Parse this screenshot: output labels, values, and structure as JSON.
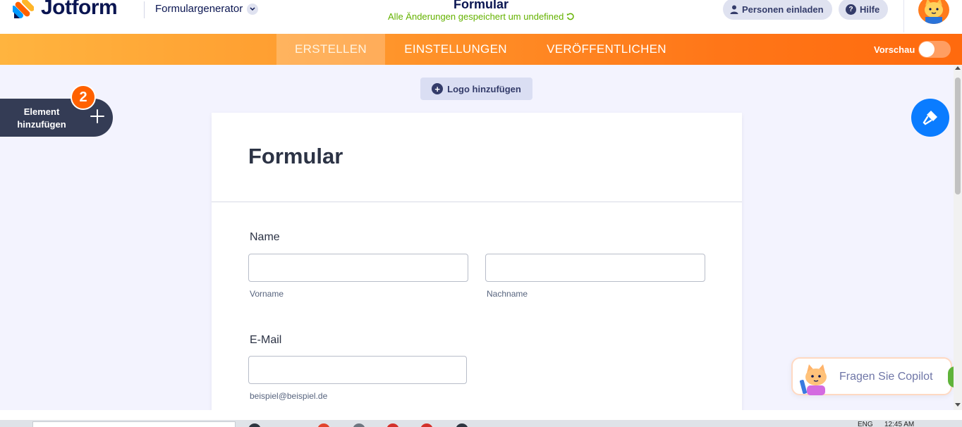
{
  "header": {
    "brand": "Jotform",
    "builder_label": "Formulargenerator",
    "form_title": "Formular",
    "save_status": "Alle Änderungen gespeichert um undefined",
    "invite_label": "Personen einladen",
    "help_label": "Hilfe"
  },
  "nav": {
    "tabs": [
      {
        "label": "ERSTELLEN",
        "active": true
      },
      {
        "label": "EINSTELLUNGEN",
        "active": false
      },
      {
        "label": "VERÖFFENTLICHEN",
        "active": false
      }
    ],
    "preview_label": "Vorschau",
    "preview_on": false
  },
  "sidebar": {
    "add_element_label": "Element hinzufügen",
    "badge_count": "2"
  },
  "canvas": {
    "add_logo_label": "Logo hinzufügen"
  },
  "form": {
    "title": "Formular",
    "name_label": "Name",
    "first_name_sublabel": "Vorname",
    "last_name_sublabel": "Nachname",
    "email_label": "E-Mail",
    "email_sublabel": "beispiel@beispiel.de"
  },
  "copilot": {
    "label": "Fragen Sie Copilot"
  },
  "taskbar": {
    "lang": "ENG",
    "time": "12:45 AM"
  },
  "colors": {
    "brand_navy": "#0a1551",
    "nav_orange_start": "#ffb43f",
    "nav_orange_end": "#ff6a0e",
    "badge_orange": "#ff6100",
    "paint_blue": "#0a7cff",
    "save_green": "#64b200"
  },
  "icons": [
    "jotform-logo-icon",
    "chevron-down-icon",
    "user-icon",
    "help-icon",
    "avatar-icon",
    "plus-icon",
    "plus-circle-icon",
    "paint-roller-icon",
    "copilot-cat-icon",
    "refresh-icon"
  ]
}
